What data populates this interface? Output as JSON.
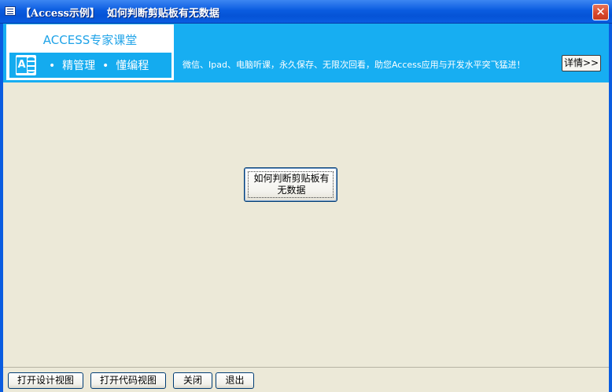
{
  "window": {
    "title": "【Access示例】  如何判断剪贴板有无数据",
    "close_label": "✕"
  },
  "banner": {
    "logo_title": "ACCESS专家课堂",
    "slogan": "•  精管理  •  懂编程",
    "access_icon_letter": "A",
    "promo_text": "微信、Ipad、电脑听课，永久保存、无限次回看，助您Access应用与开发水平突飞猛进！",
    "details_button": "详情>>",
    "background_color": "#17aef2"
  },
  "main": {
    "check_button": "如何判断剪贴板有无数据"
  },
  "footer": {
    "open_design_view": "打开设计视图",
    "open_code_view": "打开代码视图",
    "close": "关闭",
    "exit": "退出"
  },
  "icons": [
    "form-icon",
    "close-icon",
    "access-icon"
  ]
}
